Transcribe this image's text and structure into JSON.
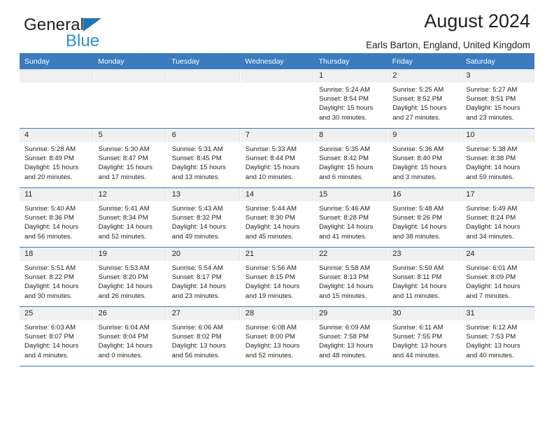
{
  "brand": {
    "name_top": "General",
    "name_bottom": "Blue",
    "triangle_icon": "triangle-icon",
    "accent_blue": "#2b8fd6",
    "header_blue": "#3a7cbe"
  },
  "header": {
    "title": "August 2024",
    "location": "Earls Barton, England, United Kingdom"
  },
  "calendar": {
    "weekday_headers": [
      "Sunday",
      "Monday",
      "Tuesday",
      "Wednesday",
      "Thursday",
      "Friday",
      "Saturday"
    ],
    "weeks": [
      [
        {
          "day": "",
          "empty": true
        },
        {
          "day": "",
          "empty": true
        },
        {
          "day": "",
          "empty": true
        },
        {
          "day": "",
          "empty": true
        },
        {
          "day": "1",
          "sunrise": "Sunrise: 5:24 AM",
          "sunset": "Sunset: 8:54 PM",
          "daylight_line1": "Daylight: 15 hours",
          "daylight_line2": "and 30 minutes."
        },
        {
          "day": "2",
          "sunrise": "Sunrise: 5:25 AM",
          "sunset": "Sunset: 8:52 PM",
          "daylight_line1": "Daylight: 15 hours",
          "daylight_line2": "and 27 minutes."
        },
        {
          "day": "3",
          "sunrise": "Sunrise: 5:27 AM",
          "sunset": "Sunset: 8:51 PM",
          "daylight_line1": "Daylight: 15 hours",
          "daylight_line2": "and 23 minutes."
        }
      ],
      [
        {
          "day": "4",
          "sunrise": "Sunrise: 5:28 AM",
          "sunset": "Sunset: 8:49 PM",
          "daylight_line1": "Daylight: 15 hours",
          "daylight_line2": "and 20 minutes."
        },
        {
          "day": "5",
          "sunrise": "Sunrise: 5:30 AM",
          "sunset": "Sunset: 8:47 PM",
          "daylight_line1": "Daylight: 15 hours",
          "daylight_line2": "and 17 minutes."
        },
        {
          "day": "6",
          "sunrise": "Sunrise: 5:31 AM",
          "sunset": "Sunset: 8:45 PM",
          "daylight_line1": "Daylight: 15 hours",
          "daylight_line2": "and 13 minutes."
        },
        {
          "day": "7",
          "sunrise": "Sunrise: 5:33 AM",
          "sunset": "Sunset: 8:44 PM",
          "daylight_line1": "Daylight: 15 hours",
          "daylight_line2": "and 10 minutes."
        },
        {
          "day": "8",
          "sunrise": "Sunrise: 5:35 AM",
          "sunset": "Sunset: 8:42 PM",
          "daylight_line1": "Daylight: 15 hours",
          "daylight_line2": "and 6 minutes."
        },
        {
          "day": "9",
          "sunrise": "Sunrise: 5:36 AM",
          "sunset": "Sunset: 8:40 PM",
          "daylight_line1": "Daylight: 15 hours",
          "daylight_line2": "and 3 minutes."
        },
        {
          "day": "10",
          "sunrise": "Sunrise: 5:38 AM",
          "sunset": "Sunset: 8:38 PM",
          "daylight_line1": "Daylight: 14 hours",
          "daylight_line2": "and 59 minutes."
        }
      ],
      [
        {
          "day": "11",
          "sunrise": "Sunrise: 5:40 AM",
          "sunset": "Sunset: 8:36 PM",
          "daylight_line1": "Daylight: 14 hours",
          "daylight_line2": "and 56 minutes."
        },
        {
          "day": "12",
          "sunrise": "Sunrise: 5:41 AM",
          "sunset": "Sunset: 8:34 PM",
          "daylight_line1": "Daylight: 14 hours",
          "daylight_line2": "and 52 minutes."
        },
        {
          "day": "13",
          "sunrise": "Sunrise: 5:43 AM",
          "sunset": "Sunset: 8:32 PM",
          "daylight_line1": "Daylight: 14 hours",
          "daylight_line2": "and 49 minutes."
        },
        {
          "day": "14",
          "sunrise": "Sunrise: 5:44 AM",
          "sunset": "Sunset: 8:30 PM",
          "daylight_line1": "Daylight: 14 hours",
          "daylight_line2": "and 45 minutes."
        },
        {
          "day": "15",
          "sunrise": "Sunrise: 5:46 AM",
          "sunset": "Sunset: 8:28 PM",
          "daylight_line1": "Daylight: 14 hours",
          "daylight_line2": "and 41 minutes."
        },
        {
          "day": "16",
          "sunrise": "Sunrise: 5:48 AM",
          "sunset": "Sunset: 8:26 PM",
          "daylight_line1": "Daylight: 14 hours",
          "daylight_line2": "and 38 minutes."
        },
        {
          "day": "17",
          "sunrise": "Sunrise: 5:49 AM",
          "sunset": "Sunset: 8:24 PM",
          "daylight_line1": "Daylight: 14 hours",
          "daylight_line2": "and 34 minutes."
        }
      ],
      [
        {
          "day": "18",
          "sunrise": "Sunrise: 5:51 AM",
          "sunset": "Sunset: 8:22 PM",
          "daylight_line1": "Daylight: 14 hours",
          "daylight_line2": "and 30 minutes."
        },
        {
          "day": "19",
          "sunrise": "Sunrise: 5:53 AM",
          "sunset": "Sunset: 8:20 PM",
          "daylight_line1": "Daylight: 14 hours",
          "daylight_line2": "and 26 minutes."
        },
        {
          "day": "20",
          "sunrise": "Sunrise: 5:54 AM",
          "sunset": "Sunset: 8:17 PM",
          "daylight_line1": "Daylight: 14 hours",
          "daylight_line2": "and 23 minutes."
        },
        {
          "day": "21",
          "sunrise": "Sunrise: 5:56 AM",
          "sunset": "Sunset: 8:15 PM",
          "daylight_line1": "Daylight: 14 hours",
          "daylight_line2": "and 19 minutes."
        },
        {
          "day": "22",
          "sunrise": "Sunrise: 5:58 AM",
          "sunset": "Sunset: 8:13 PM",
          "daylight_line1": "Daylight: 14 hours",
          "daylight_line2": "and 15 minutes."
        },
        {
          "day": "23",
          "sunrise": "Sunrise: 5:59 AM",
          "sunset": "Sunset: 8:11 PM",
          "daylight_line1": "Daylight: 14 hours",
          "daylight_line2": "and 11 minutes."
        },
        {
          "day": "24",
          "sunrise": "Sunrise: 6:01 AM",
          "sunset": "Sunset: 8:09 PM",
          "daylight_line1": "Daylight: 14 hours",
          "daylight_line2": "and 7 minutes."
        }
      ],
      [
        {
          "day": "25",
          "sunrise": "Sunrise: 6:03 AM",
          "sunset": "Sunset: 8:07 PM",
          "daylight_line1": "Daylight: 14 hours",
          "daylight_line2": "and 4 minutes."
        },
        {
          "day": "26",
          "sunrise": "Sunrise: 6:04 AM",
          "sunset": "Sunset: 8:04 PM",
          "daylight_line1": "Daylight: 14 hours",
          "daylight_line2": "and 0 minutes."
        },
        {
          "day": "27",
          "sunrise": "Sunrise: 6:06 AM",
          "sunset": "Sunset: 8:02 PM",
          "daylight_line1": "Daylight: 13 hours",
          "daylight_line2": "and 56 minutes."
        },
        {
          "day": "28",
          "sunrise": "Sunrise: 6:08 AM",
          "sunset": "Sunset: 8:00 PM",
          "daylight_line1": "Daylight: 13 hours",
          "daylight_line2": "and 52 minutes."
        },
        {
          "day": "29",
          "sunrise": "Sunrise: 6:09 AM",
          "sunset": "Sunset: 7:58 PM",
          "daylight_line1": "Daylight: 13 hours",
          "daylight_line2": "and 48 minutes."
        },
        {
          "day": "30",
          "sunrise": "Sunrise: 6:11 AM",
          "sunset": "Sunset: 7:55 PM",
          "daylight_line1": "Daylight: 13 hours",
          "daylight_line2": "and 44 minutes."
        },
        {
          "day": "31",
          "sunrise": "Sunrise: 6:12 AM",
          "sunset": "Sunset: 7:53 PM",
          "daylight_line1": "Daylight: 13 hours",
          "daylight_line2": "and 40 minutes."
        }
      ]
    ]
  }
}
